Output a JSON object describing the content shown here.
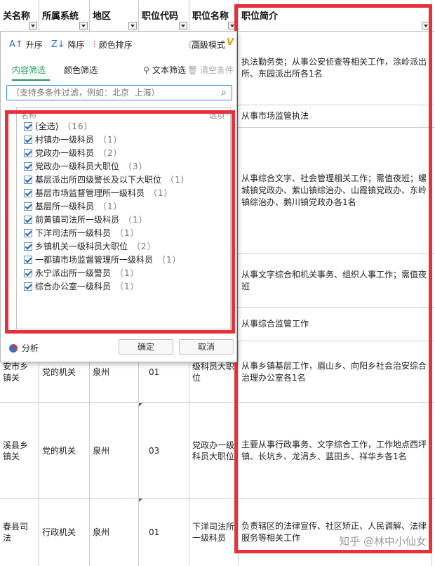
{
  "sheet": {
    "headers": [
      "关名称",
      "所属系统",
      "地区",
      "职位代码",
      "职位名称",
      "职位简介"
    ],
    "top_rows": [
      {
        "desc": "执法勤务类；从事公安侦查等相关工作，涂岭派出所、东园派出所各1名"
      },
      {
        "desc": "从事市场监管执法"
      },
      {
        "desc": "从事综合文字、社会管理相关工作；需值夜班；螺城镇党政办、紫山镇综治办、山霞镇党政办、东岭镇综治办、鹅川镇党政办各1名"
      },
      {
        "desc": "从事文字综合和机关事务、组织人事工作；需值夜班"
      },
      {
        "desc": "从事综合监管工作"
      }
    ],
    "rows": [
      {
        "name": "安市乡镇关",
        "system": "党的机关",
        "region": "泉州",
        "code": "01",
        "title": "级科员大职位",
        "desc": "从事乡镇基层工作，眉山乡、向阳乡社会治安综合治理办公室各1名"
      },
      {
        "name": "溪县乡镇关",
        "system": "党的机关",
        "region": "泉州",
        "code": "03",
        "title": "党政办一级科员大职位",
        "desc": "主要从事行政事务、文字综合工作，工作地点西坪镇、长坑乡、龙涓乡、蓝田乡、祥华乡各1名"
      },
      {
        "name": "春县司法",
        "system": "行政机关",
        "region": "泉州",
        "code": "01",
        "title": "下洋司法所一级科员",
        "desc": "负责辖区的法律宣传、社区矫正、人民调解、法律服务等相关工作"
      }
    ]
  },
  "popup": {
    "sort_asc": "升序",
    "sort_desc": "降序",
    "color_sort": "颜色排序",
    "advanced_mode": "高级模式",
    "tab_content": "内容筛选",
    "tab_color": "颜色筛选",
    "text_filter": "文本筛选",
    "clear_condition": "清空条件",
    "search_placeholder": "（支持多条件过滤，例如：北京  上海）",
    "list_header": "名称",
    "list_header_right": "选项",
    "items": [
      {
        "label": "(全选)",
        "count": "（16）"
      },
      {
        "label": "村镇办一级科员",
        "count": "（1）"
      },
      {
        "label": "党政办一级科员",
        "count": "（2）"
      },
      {
        "label": "党政办一级科员大职位",
        "count": "（3）"
      },
      {
        "label": "基层派出所四级警长及以下大职位",
        "count": "（1）"
      },
      {
        "label": "基层市场监督管理所一级科员",
        "count": "（1）"
      },
      {
        "label": "基层所一级科员",
        "count": "（1）"
      },
      {
        "label": "前黄镇司法所一级科员",
        "count": "（1）"
      },
      {
        "label": "下洋司法所一级科员",
        "count": "（1）"
      },
      {
        "label": "乡镇机关一级科员大职位",
        "count": "（2）"
      },
      {
        "label": "一都镇市场监督管理所一级科员",
        "count": "（1）"
      },
      {
        "label": "永宁派出所一级警员",
        "count": "（1）"
      },
      {
        "label": "综合办公室一级科员",
        "count": "（1）"
      }
    ],
    "analyze": "分析",
    "ok": "确定",
    "cancel": "取消"
  },
  "watermark": "知乎 @林中小仙女",
  "colors": {
    "highlight_red": "#e8303b",
    "tab_green": "#1f9a54",
    "focus_blue": "#3d8de0"
  }
}
